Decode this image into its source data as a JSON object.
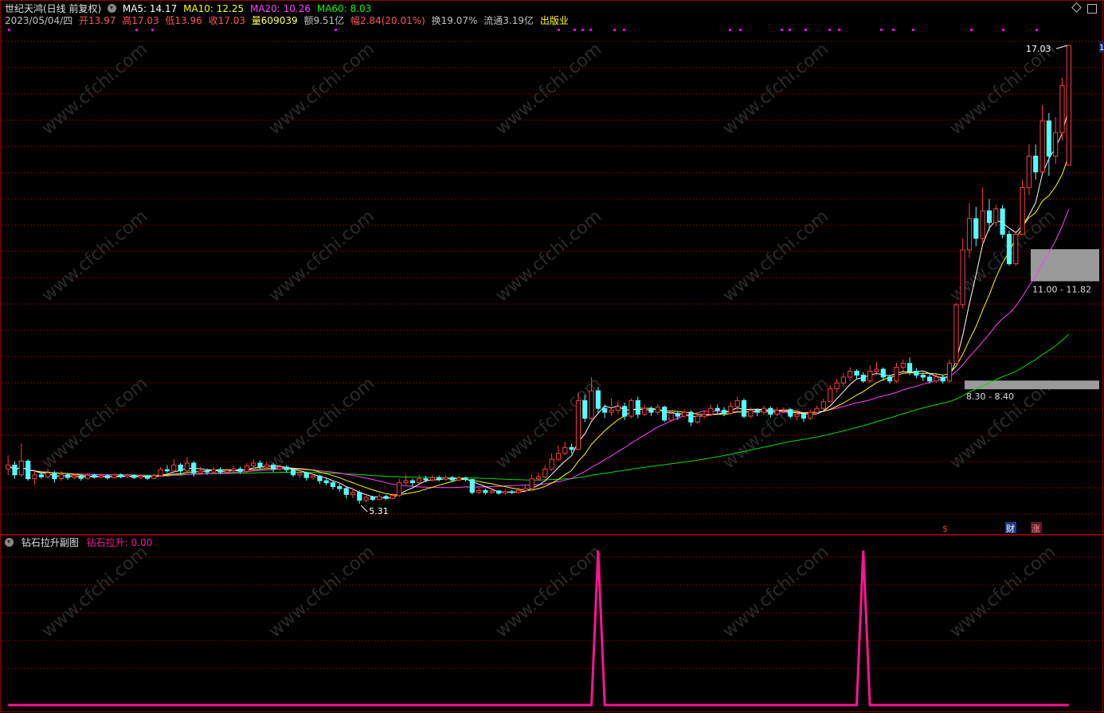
{
  "header": {
    "stock_name": "世纪天鸿(日线 前复权)",
    "ma": [
      {
        "label": "MA5: 14.17",
        "color": "#ffffff"
      },
      {
        "label": "MA10: 12.25",
        "color": "#ffff00"
      },
      {
        "label": "MA20: 10.26",
        "color": "#ff40ff"
      },
      {
        "label": "MA60: 8.03",
        "color": "#00ff00"
      }
    ],
    "info": [
      {
        "text": "2023/05/04/四",
        "color": "#c0c0c0"
      },
      {
        "text": "开13.97",
        "color": "#ff5555"
      },
      {
        "text": "高17.03",
        "color": "#ff5555"
      },
      {
        "text": "低13.96",
        "color": "#ff5555"
      },
      {
        "text": "收17.03",
        "color": "#ff5555"
      },
      {
        "text": "量609039",
        "color": "#ffff55"
      },
      {
        "text": "额9.51亿",
        "color": "#c0c0c0"
      },
      {
        "text": "幅2.84(20.01%)",
        "color": "#ff5555"
      },
      {
        "text": "换19.07%",
        "color": "#c0c0c0"
      },
      {
        "text": "流通3.19亿",
        "color": "#c0c0c0"
      },
      {
        "text": "出版业",
        "color": "#ffff00"
      }
    ]
  },
  "annotations": {
    "high_label": "17.03",
    "low_label": "5.31",
    "zone_upper_label": "11.00 - 11.82",
    "zone_lower_label": "8.30 - 8.40",
    "marker_dollar": "$",
    "marker_cai": "财",
    "marker_zhang": "涨",
    "right_edge_label": "1"
  },
  "sub_header": {
    "title": "钻石拉升副图",
    "indicator": "钻石拉升: 0.00"
  },
  "watermark": "www.cfchi.com",
  "colors": {
    "up": "#ff3c3c",
    "down": "#54ffff",
    "grid": "#7a0000",
    "ma5": "#ffffff",
    "ma10": "#ffff00",
    "ma20": "#ff40ff",
    "ma60": "#00dd00",
    "signal": "#ff1493",
    "magenta_dot": "#ff00ff"
  },
  "chart_data": [
    {
      "type": "candlestick",
      "title": "世纪天鸿(日线 前复权)",
      "y_range": [
        4.6,
        17.5
      ],
      "extremes": {
        "high": 17.03,
        "low": 5.31
      },
      "last_bar": {
        "date": "2023/05/04",
        "open": 13.97,
        "high": 17.03,
        "low": 13.96,
        "close": 17.03
      },
      "ma_last": {
        "MA5": 14.17,
        "MA10": 12.25,
        "MA20": 10.26,
        "MA60": 8.03
      },
      "zones": [
        {
          "low": 11.0,
          "high": 11.82
        },
        {
          "low": 8.3,
          "high": 8.4
        }
      ],
      "candles": [
        [
          6.2,
          6.3,
          6.55,
          6.05
        ],
        [
          6.3,
          6.05,
          6.4,
          5.95
        ],
        [
          6.05,
          6.4,
          6.85,
          6.0
        ],
        [
          6.4,
          5.95,
          6.45,
          5.9
        ],
        [
          5.95,
          6.05,
          6.2,
          5.8
        ],
        [
          6.05,
          6.0,
          6.15,
          5.95
        ],
        [
          6.0,
          6.1,
          6.2,
          5.95
        ],
        [
          6.1,
          5.95,
          6.15,
          5.85
        ],
        [
          5.95,
          6.05,
          6.15,
          5.9
        ],
        [
          6.05,
          5.98,
          6.1,
          5.92
        ],
        [
          5.98,
          6.02,
          6.08,
          5.94
        ],
        [
          6.02,
          5.96,
          6.06,
          5.9
        ],
        [
          5.96,
          6.04,
          6.1,
          5.93
        ],
        [
          6.04,
          5.99,
          6.08,
          5.95
        ],
        [
          5.99,
          6.03,
          6.07,
          5.96
        ],
        [
          6.03,
          5.97,
          6.06,
          5.93
        ],
        [
          5.97,
          6.05,
          6.1,
          5.95
        ],
        [
          6.05,
          6.0,
          6.09,
          5.96
        ],
        [
          6.0,
          6.04,
          6.08,
          5.97
        ],
        [
          6.04,
          5.98,
          6.07,
          5.94
        ],
        [
          5.98,
          6.02,
          6.06,
          5.95
        ],
        [
          6.02,
          5.96,
          6.05,
          5.92
        ],
        [
          5.96,
          6.03,
          6.08,
          5.94
        ],
        [
          6.03,
          6.18,
          6.25,
          6.0
        ],
        [
          6.18,
          6.15,
          6.3,
          6.1
        ],
        [
          6.15,
          6.3,
          6.45,
          6.1
        ],
        [
          6.3,
          6.15,
          6.35,
          6.05
        ],
        [
          6.15,
          6.35,
          6.5,
          6.1
        ],
        [
          6.35,
          6.1,
          6.4,
          6.0
        ],
        [
          6.1,
          6.15,
          6.25,
          6.05
        ],
        [
          6.15,
          6.12,
          6.22,
          6.05
        ],
        [
          6.12,
          6.18,
          6.25,
          6.08
        ],
        [
          6.18,
          6.12,
          6.24,
          6.06
        ],
        [
          6.12,
          6.16,
          6.22,
          6.08
        ],
        [
          6.16,
          6.2,
          6.28,
          6.1
        ],
        [
          6.2,
          6.14,
          6.26,
          6.08
        ],
        [
          6.14,
          6.28,
          6.35,
          6.1
        ],
        [
          6.28,
          6.35,
          6.45,
          6.22
        ],
        [
          6.35,
          6.25,
          6.42,
          6.18
        ],
        [
          6.25,
          6.3,
          6.38,
          6.2
        ],
        [
          6.3,
          6.2,
          6.35,
          6.12
        ],
        [
          6.2,
          6.25,
          6.32,
          6.15
        ],
        [
          6.25,
          6.18,
          6.3,
          6.1
        ],
        [
          6.18,
          6.05,
          6.22,
          6.0
        ],
        [
          6.05,
          6.1,
          6.18,
          5.98
        ],
        [
          6.1,
          5.98,
          6.14,
          5.9
        ],
        [
          5.98,
          6.02,
          6.08,
          5.92
        ],
        [
          6.02,
          5.9,
          6.05,
          5.82
        ],
        [
          5.9,
          5.85,
          5.96,
          5.78
        ],
        [
          5.85,
          5.75,
          5.9,
          5.68
        ],
        [
          5.75,
          5.7,
          5.82,
          5.62
        ],
        [
          5.7,
          5.55,
          5.75,
          5.45
        ],
        [
          5.55,
          5.6,
          5.7,
          5.45
        ],
        [
          5.6,
          5.4,
          5.65,
          5.31
        ],
        [
          5.4,
          5.48,
          5.55,
          5.35
        ],
        [
          5.48,
          5.42,
          5.52,
          5.38
        ],
        [
          5.42,
          5.5,
          5.56,
          5.4
        ],
        [
          5.5,
          5.45,
          5.54,
          5.4
        ],
        [
          5.45,
          5.52,
          5.58,
          5.42
        ],
        [
          5.52,
          5.85,
          5.95,
          5.48
        ],
        [
          5.85,
          5.9,
          6.05,
          5.8
        ],
        [
          5.9,
          5.85,
          5.95,
          5.75
        ],
        [
          5.85,
          5.95,
          6.05,
          5.82
        ],
        [
          5.95,
          5.92,
          6.02,
          5.86
        ],
        [
          5.92,
          5.98,
          6.05,
          5.88
        ],
        [
          5.98,
          5.94,
          6.03,
          5.88
        ],
        [
          5.94,
          5.98,
          6.04,
          5.9
        ],
        [
          5.98,
          5.92,
          6.02,
          5.86
        ],
        [
          5.92,
          5.97,
          6.02,
          5.88
        ],
        [
          5.97,
          5.93,
          6.0,
          5.88
        ],
        [
          5.93,
          5.6,
          5.95,
          5.55
        ],
        [
          5.6,
          5.65,
          5.72,
          5.55
        ],
        [
          5.65,
          5.6,
          5.7,
          5.55
        ],
        [
          5.6,
          5.64,
          5.68,
          5.57
        ],
        [
          5.64,
          5.58,
          5.66,
          5.54
        ],
        [
          5.58,
          5.62,
          5.68,
          5.55
        ],
        [
          5.62,
          5.6,
          5.66,
          5.56
        ],
        [
          5.6,
          5.65,
          5.72,
          5.56
        ],
        [
          5.65,
          5.7,
          5.78,
          5.6
        ],
        [
          5.7,
          5.95,
          6.05,
          5.65
        ],
        [
          5.95,
          6.0,
          6.1,
          5.9
        ],
        [
          6.0,
          6.2,
          6.3,
          5.95
        ],
        [
          6.2,
          6.45,
          6.6,
          6.15
        ],
        [
          6.45,
          6.6,
          6.8,
          6.4
        ],
        [
          6.6,
          6.75,
          6.9,
          6.55
        ],
        [
          6.75,
          6.7,
          6.85,
          6.6
        ],
        [
          6.7,
          7.95,
          8.15,
          6.7
        ],
        [
          7.95,
          7.5,
          8.1,
          7.4
        ],
        [
          7.5,
          8.2,
          8.55,
          7.45
        ],
        [
          8.2,
          7.75,
          8.3,
          7.6
        ],
        [
          7.75,
          7.65,
          7.85,
          7.5
        ],
        [
          7.65,
          7.7,
          8.0,
          7.55
        ],
        [
          7.7,
          7.8,
          7.95,
          7.6
        ],
        [
          7.8,
          7.55,
          7.9,
          7.45
        ],
        [
          7.55,
          7.95,
          8.0,
          7.5
        ],
        [
          7.95,
          7.6,
          8.05,
          7.5
        ],
        [
          7.6,
          7.75,
          7.85,
          7.55
        ],
        [
          7.75,
          7.65,
          7.8,
          7.55
        ],
        [
          7.65,
          7.78,
          7.85,
          7.58
        ],
        [
          7.78,
          7.45,
          7.82,
          7.4
        ],
        [
          7.45,
          7.62,
          7.7,
          7.4
        ],
        [
          7.62,
          7.55,
          7.68,
          7.45
        ],
        [
          7.55,
          7.65,
          7.72,
          7.5
        ],
        [
          7.65,
          7.4,
          7.7,
          7.3
        ],
        [
          7.4,
          7.55,
          7.65,
          7.35
        ],
        [
          7.55,
          7.6,
          7.7,
          7.48
        ],
        [
          7.6,
          7.75,
          7.85,
          7.55
        ],
        [
          7.75,
          7.7,
          7.85,
          7.62
        ],
        [
          7.7,
          7.62,
          7.78,
          7.55
        ],
        [
          7.62,
          7.8,
          7.92,
          7.58
        ],
        [
          7.8,
          7.95,
          8.05,
          7.7
        ],
        [
          7.95,
          7.55,
          8.0,
          7.5
        ],
        [
          7.55,
          7.7,
          7.78,
          7.5
        ],
        [
          7.7,
          7.65,
          7.75,
          7.55
        ],
        [
          7.65,
          7.75,
          7.82,
          7.58
        ],
        [
          7.75,
          7.6,
          7.8,
          7.52
        ],
        [
          7.6,
          7.7,
          7.78,
          7.55
        ],
        [
          7.7,
          7.72,
          7.78,
          7.62
        ],
        [
          7.72,
          7.55,
          7.75,
          7.5
        ],
        [
          7.55,
          7.6,
          7.68,
          7.45
        ],
        [
          7.6,
          7.5,
          7.65,
          7.4
        ],
        [
          7.5,
          7.65,
          7.72,
          7.45
        ],
        [
          7.65,
          7.75,
          7.82,
          7.6
        ],
        [
          7.75,
          7.92,
          8.0,
          7.7
        ],
        [
          7.92,
          8.25,
          8.35,
          7.9
        ],
        [
          8.25,
          8.4,
          8.5,
          8.15
        ],
        [
          8.4,
          8.55,
          8.65,
          8.3
        ],
        [
          8.55,
          8.7,
          8.8,
          8.45
        ],
        [
          8.7,
          8.6,
          8.75,
          8.5
        ],
        [
          8.6,
          8.45,
          8.68,
          8.4
        ],
        [
          8.45,
          8.7,
          8.85,
          8.4
        ],
        [
          8.7,
          8.75,
          8.95,
          8.6
        ],
        [
          8.75,
          8.55,
          8.8,
          8.45
        ],
        [
          8.55,
          8.45,
          8.62,
          8.38
        ],
        [
          8.45,
          8.8,
          8.92,
          8.4
        ],
        [
          8.8,
          8.9,
          9.0,
          8.7
        ],
        [
          8.9,
          8.7,
          9.05,
          8.6
        ],
        [
          8.7,
          8.6,
          8.78,
          8.52
        ],
        [
          8.6,
          8.55,
          8.68,
          8.45
        ],
        [
          8.55,
          8.45,
          8.62,
          8.38
        ],
        [
          8.45,
          8.55,
          8.62,
          8.4
        ],
        [
          8.55,
          8.45,
          8.6,
          8.38
        ],
        [
          8.45,
          8.9,
          9.0,
          8.4
        ],
        [
          8.9,
          10.4,
          10.45,
          8.9
        ],
        [
          10.4,
          11.8,
          12.1,
          10.3
        ],
        [
          11.8,
          12.6,
          13.0,
          11.6
        ],
        [
          12.6,
          12.1,
          12.9,
          11.9
        ],
        [
          12.1,
          12.8,
          13.4,
          12.0
        ],
        [
          12.8,
          12.5,
          13.1,
          12.3
        ],
        [
          12.5,
          12.85,
          12.95,
          12.4
        ],
        [
          12.85,
          12.2,
          12.95,
          12.1
        ],
        [
          12.2,
          11.45,
          12.3,
          11.4
        ],
        [
          11.45,
          12.2,
          12.3,
          11.4
        ],
        [
          12.2,
          13.4,
          13.6,
          12.2
        ],
        [
          13.4,
          14.2,
          14.5,
          13.2
        ],
        [
          14.2,
          13.8,
          14.5,
          13.6
        ],
        [
          13.8,
          15.1,
          15.5,
          13.8
        ],
        [
          15.1,
          14.2,
          15.3,
          13.7
        ],
        [
          14.2,
          14.8,
          15.2,
          14.0
        ],
        [
          14.8,
          16.0,
          16.2,
          14.6
        ],
        [
          13.97,
          17.03,
          17.03,
          13.96
        ]
      ]
    },
    {
      "type": "line",
      "title": "钻石拉升副图",
      "series": [
        {
          "name": "钻石拉升",
          "last_value": 0.0,
          "spikes_at_bar": [
            89,
            129
          ],
          "spike_value": 1
        }
      ]
    }
  ]
}
